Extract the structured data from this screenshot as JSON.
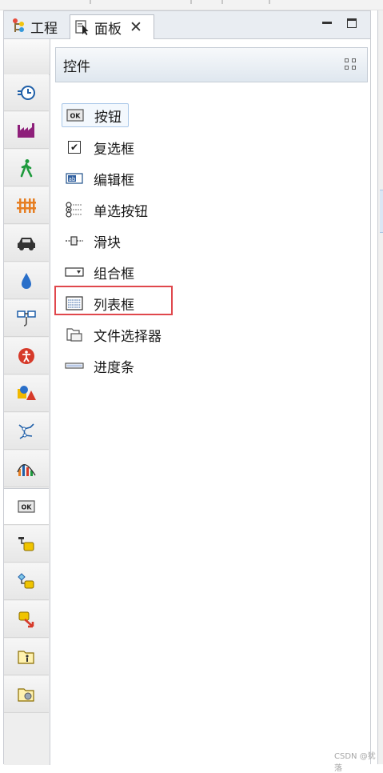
{
  "tabs": {
    "inactive_label": "工程",
    "active_label": "面板",
    "close_glyph": "✕"
  },
  "window_buttons": {
    "minimize": "minimize-icon",
    "maximize": "maximize-icon"
  },
  "category_bar": {
    "items": [
      {
        "name": "clock-icon"
      },
      {
        "name": "factory-icon"
      },
      {
        "name": "walking-person-icon"
      },
      {
        "name": "fence-icon"
      },
      {
        "name": "car-icon"
      },
      {
        "name": "water-drop-icon"
      },
      {
        "name": "connector-icon"
      },
      {
        "name": "accessibility-icon"
      },
      {
        "name": "shapes-icon"
      },
      {
        "name": "network-icon"
      },
      {
        "name": "chart-icon"
      },
      {
        "name": "ok-button-icon",
        "label": "OK",
        "selected": true
      },
      {
        "name": "process-flow-icon"
      },
      {
        "name": "process-shapes-icon"
      },
      {
        "name": "process-exit-icon"
      },
      {
        "name": "folder-person-icon"
      },
      {
        "name": "folder-gear-icon"
      }
    ]
  },
  "section": {
    "title": "控件"
  },
  "widgets": [
    {
      "label": "按钮",
      "icon": "button-icon",
      "icon_text": "OK"
    },
    {
      "label": "复选框",
      "icon": "checkbox-icon",
      "icon_text": "✔"
    },
    {
      "label": "编辑框",
      "icon": "edit-box-icon",
      "icon_text": "ab"
    },
    {
      "label": "单选按钮",
      "icon": "radio-button-icon"
    },
    {
      "label": "滑块",
      "icon": "slider-icon"
    },
    {
      "label": "组合框",
      "icon": "combo-box-icon"
    },
    {
      "label": "列表框",
      "icon": "list-box-icon"
    },
    {
      "label": "文件选择器",
      "icon": "file-chooser-icon"
    },
    {
      "label": "进度条",
      "icon": "progress-bar-icon"
    }
  ],
  "watermark": "CSDN @犹落",
  "colors": {
    "highlight": "#e0474c",
    "focus": "#a9c7e8"
  }
}
